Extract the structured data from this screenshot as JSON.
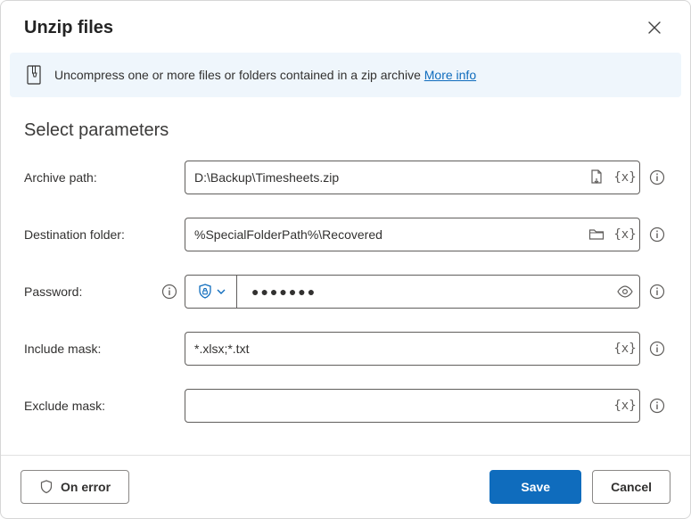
{
  "dialog": {
    "title": "Unzip files",
    "banner_text": "Uncompress one or more files or folders contained in a zip archive ",
    "banner_link": "More info"
  },
  "section_title": "Select parameters",
  "fields": {
    "archive_path": {
      "label": "Archive path:",
      "value": "D:\\Backup\\Timesheets.zip"
    },
    "destination": {
      "label": "Destination folder:",
      "value": "%SpecialFolderPath%\\Recovered"
    },
    "password": {
      "label": "Password:",
      "value": "●●●●●●●"
    },
    "include_mask": {
      "label": "Include mask:",
      "value": "*.xlsx;*.txt"
    },
    "exclude_mask": {
      "label": "Exclude mask:",
      "value": ""
    }
  },
  "var_token": "{x}",
  "buttons": {
    "on_error": "On error",
    "save": "Save",
    "cancel": "Cancel"
  }
}
